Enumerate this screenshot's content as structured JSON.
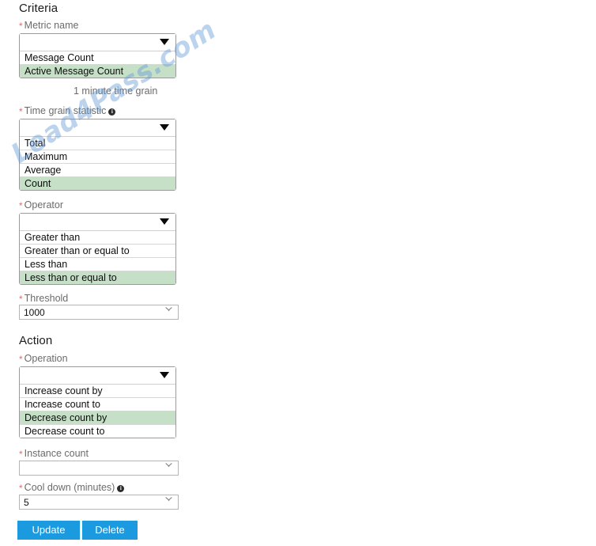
{
  "criteria": {
    "heading": "Criteria",
    "metric_name": {
      "label": "Metric name",
      "required_marker": "*",
      "value": "",
      "options": [
        "Message Count",
        "Active Message Count"
      ],
      "selected": "Active Message Count",
      "caret_icon": "chevron-down-icon"
    },
    "time_grain_note": "1 minute time grain",
    "time_grain_statistic": {
      "label": "Time grain statistic",
      "required_marker": "*",
      "info_icon": "info-icon",
      "info_glyph": "i",
      "value": "",
      "options": [
        "Total",
        "Maximum",
        "Average",
        "Count"
      ],
      "selected": "Count",
      "caret_icon": "chevron-down-icon"
    },
    "operator": {
      "label": "Operator",
      "required_marker": "*",
      "value": "",
      "options": [
        "Greater than",
        "Greater than or equal to",
        "Less than",
        "Less than or equal to"
      ],
      "selected": "Less than or equal to",
      "caret_icon": "chevron-down-icon"
    },
    "threshold": {
      "label": "Threshold",
      "required_marker": "*",
      "value": "1000",
      "chevron_icon": "chevron-down-icon"
    }
  },
  "action": {
    "heading": "Action",
    "operation": {
      "label": "Operation",
      "required_marker": "*",
      "value": "",
      "options": [
        "Increase count by",
        "Increase count to",
        "Decrease count by",
        "Decrease count to"
      ],
      "selected": "Decrease count by",
      "caret_icon": "chevron-down-icon"
    },
    "instance_count": {
      "label": "Instance count",
      "required_marker": "*",
      "value": "",
      "chevron_icon": "chevron-down-icon"
    },
    "cool_down": {
      "label": "Cool down (minutes)",
      "required_marker": "*",
      "info_icon": "info-icon",
      "info_glyph": "i",
      "value": "5",
      "chevron_icon": "chevron-down-icon"
    }
  },
  "buttons": {
    "update": "Update",
    "delete": "Delete"
  },
  "watermark": {
    "text": "Lead4Pass.com"
  },
  "colors": {
    "accent_button": "#1b9ae0",
    "selected_option": "#c5e0c6",
    "required_asterisk": "#e36c6c",
    "label_text": "#6b6b6b",
    "watermark": "#6096d6"
  }
}
